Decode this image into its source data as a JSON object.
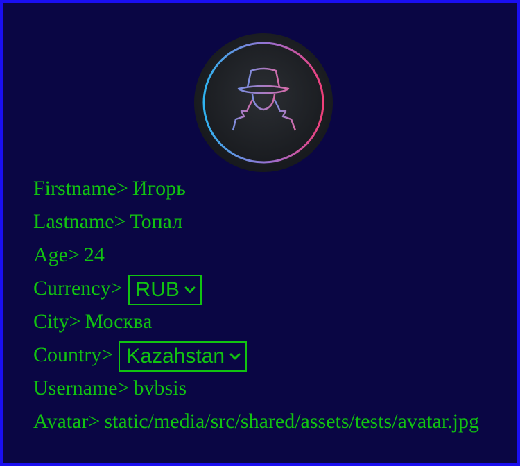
{
  "profile": {
    "firstname": {
      "label": "Firstname>",
      "value": "Игорь"
    },
    "lastname": {
      "label": "Lastname>",
      "value": "Топал"
    },
    "age": {
      "label": "Age>",
      "value": "24"
    },
    "currency": {
      "label": "Currency>",
      "selected": "RUB"
    },
    "city": {
      "label": "City>",
      "value": "Москва"
    },
    "country": {
      "label": "Country>",
      "selected": "Kazahstan"
    },
    "username": {
      "label": "Username>",
      "value": "bvbsis"
    },
    "avatar": {
      "label": "Avatar>",
      "value": "static/media/src/shared/assets/tests/avatar.jpg"
    }
  },
  "avatar_icon": "spy-incognito-icon",
  "colors": {
    "background": "#0a0644",
    "border": "#1a0ff0",
    "text": "#11c311",
    "avatar_ring_start": "#2fb3f0",
    "avatar_ring_end": "#f03f7a"
  }
}
